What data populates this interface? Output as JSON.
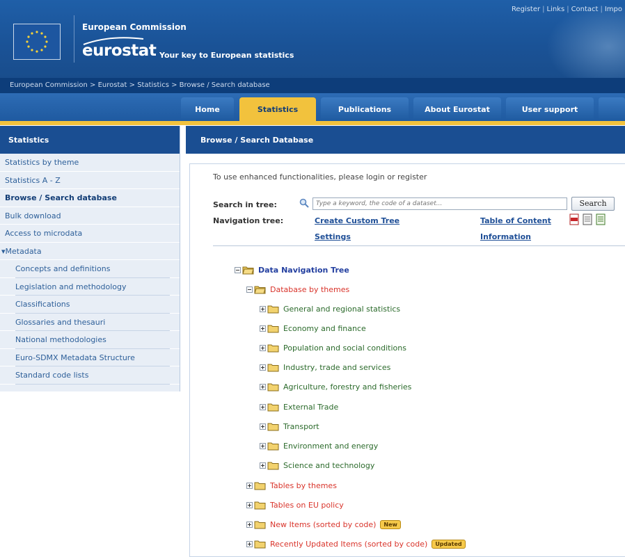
{
  "header": {
    "top_links": [
      "Register",
      "Links",
      "Contact",
      "Impo"
    ],
    "org": "European Commission",
    "brand": "eurostat",
    "tagline": "Your key to European statistics"
  },
  "breadcrumb": [
    "European Commission",
    "Eurostat",
    "Statistics",
    "Browse / Search database"
  ],
  "nav": {
    "tabs": [
      {
        "label": "Home",
        "active": false
      },
      {
        "label": "Statistics",
        "active": true
      },
      {
        "label": "Publications",
        "active": false
      },
      {
        "label": "About Eurostat",
        "active": false
      },
      {
        "label": "User support",
        "active": false
      }
    ]
  },
  "sidebar": {
    "title": "Statistics",
    "items": [
      {
        "label": "Statistics by theme",
        "style": "normal"
      },
      {
        "label": "Statistics A - Z",
        "style": "normal"
      },
      {
        "label": "Browse / Search database",
        "style": "bold"
      },
      {
        "label": "Bulk download",
        "style": "normal"
      },
      {
        "label": "Access to microdata",
        "style": "normal"
      },
      {
        "label": "▾Metadata",
        "style": "meta"
      },
      {
        "label": "Concepts and definitions",
        "style": "sub"
      },
      {
        "label": "Legislation and methodology",
        "style": "sub"
      },
      {
        "label": "Classifications",
        "style": "sub"
      },
      {
        "label": "Glossaries and thesauri",
        "style": "sub"
      },
      {
        "label": "National methodologies",
        "style": "sub"
      },
      {
        "label": "Euro-SDMX Metadata Structure",
        "style": "sub"
      },
      {
        "label": "Standard code lists",
        "style": "sub"
      }
    ]
  },
  "main": {
    "title": "Browse / Search Database",
    "login_prefix": "To use enhanced functionalities, please login or register",
    "search_label": "Search in tree:",
    "search_placeholder": "Type a keyword, the code of a dataset...",
    "search_button": "Search",
    "nav_tree_label": "Navigation tree:",
    "create_custom_tree": "Create Custom Tree",
    "settings": "Settings",
    "table_of_content": "Table of Content",
    "information": "Information"
  },
  "tree": {
    "root": "Data Navigation Tree",
    "db_by_themes": "Database by themes",
    "themes": [
      "General and regional statistics",
      "Economy and finance",
      "Population and social conditions",
      "Industry, trade and services",
      "Agriculture, forestry and fisheries",
      "External Trade",
      "Transport",
      "Environment and energy",
      "Science and technology"
    ],
    "tables_by_themes": "Tables by themes",
    "tables_on_eu_policy": "Tables on EU policy",
    "new_items": "New Items (sorted by code)",
    "new_badge": "New",
    "recent_items": "Recently Updated Items (sorted by code)",
    "updated_badge": "Updated"
  },
  "colors": {
    "header_blue": "#1f5fa8",
    "nav_active": "#f2c23d",
    "tree_red": "#d9342b",
    "tree_green": "#2b6a2b"
  }
}
